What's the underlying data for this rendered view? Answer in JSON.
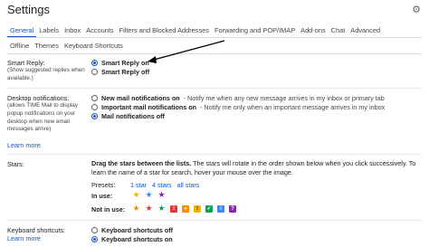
{
  "title": "Settings",
  "tabs_primary": [
    "General",
    "Labels",
    "Inbox",
    "Accounts",
    "Filters and Blocked Addresses",
    "Forwarding and POP/IMAP",
    "Add-ons",
    "Chat",
    "Advanced"
  ],
  "tabs_secondary": [
    "Offline",
    "Themes",
    "Keyboard Shortcuts"
  ],
  "smart_reply": {
    "label": "Smart Reply:",
    "sublabel": "(Show suggested replies when available.)",
    "option_on": "Smart Reply on",
    "option_off": "Smart Reply off"
  },
  "desktop": {
    "label": "Desktop notifications:",
    "sublabel": "(allows TIME Mail to display popup notifications on your desktop when new email messages arrive)",
    "learn_more": "Learn more",
    "opt1": "New mail notifications on",
    "opt1_desc": "- Notify me when any new message arrives in my inbox or primary tab",
    "opt2": "Important mail notifications on",
    "opt2_desc": "- Notify me only when an important message arrives in my inbox",
    "opt3": "Mail notifications off"
  },
  "stars": {
    "label": "Stars:",
    "drag": "Drag the stars between the lists.",
    "text": "The stars will rotate in the order shown below when you click successively. To learn the name of a star for search, hover your mouse over the image.",
    "presets_label": "Presets:",
    "preset1": "1 star",
    "preset2": "4 stars",
    "preset3": "all stars",
    "in_use": "In use:",
    "not_in_use": "Not in use:"
  },
  "keyboard": {
    "label": "Keyboard shortcuts:",
    "learn_more": "Learn more",
    "opt_off": "Keyboard shortcuts off",
    "opt_on": "Keyboard shortcuts on"
  },
  "colors": {
    "accent": "#0b57d0",
    "star_yellow": "#f4b400",
    "star_orange": "#fb8c00",
    "star_red": "#e53935",
    "star_purple": "#8e24aa",
    "star_blue": "#4285f4",
    "star_green": "#0f9d58"
  }
}
